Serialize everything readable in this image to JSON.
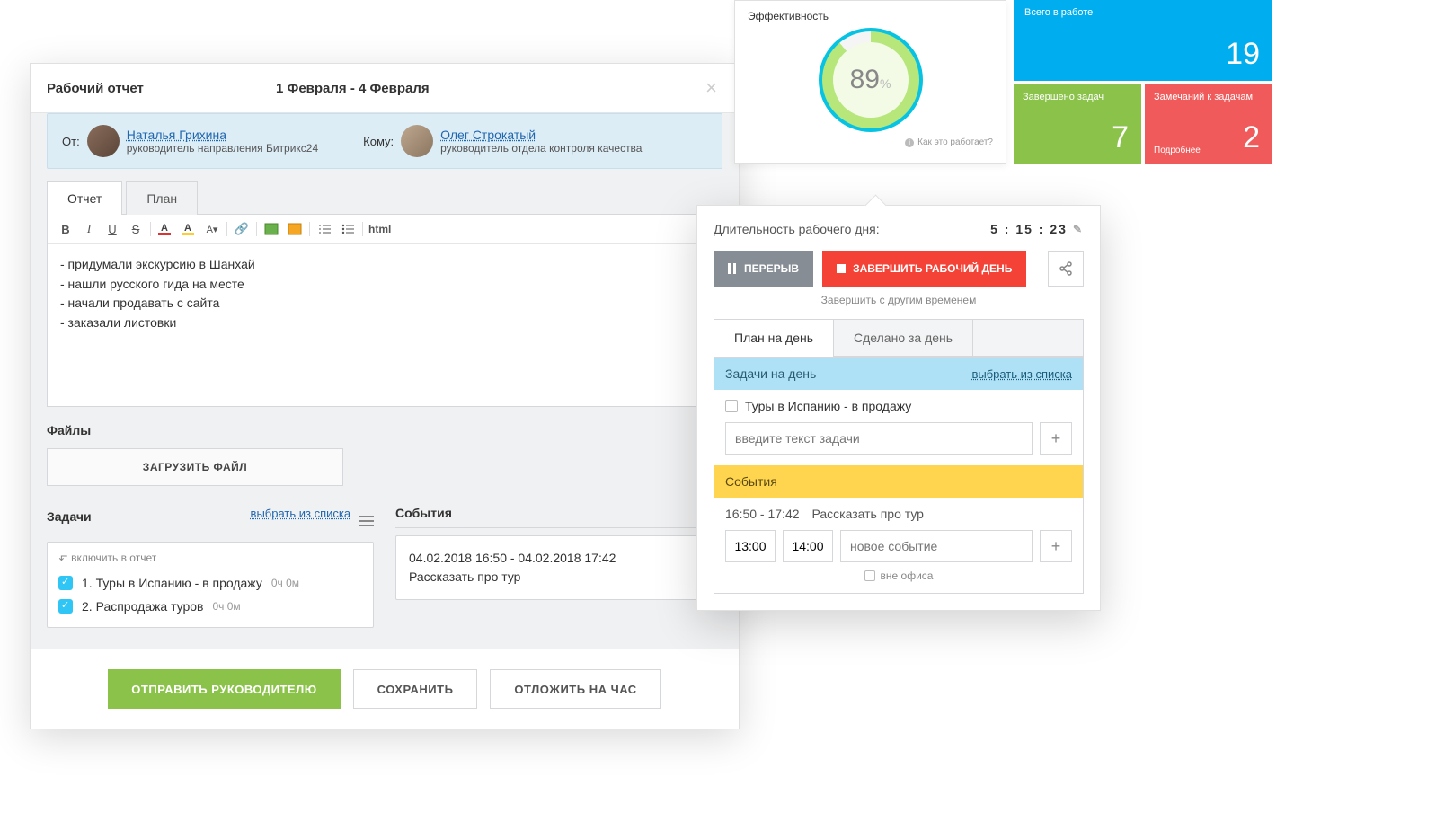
{
  "report_modal": {
    "title_left": "Рабочий отчет",
    "title_center": "1 Февраля - 4 Февраля",
    "from_label": "От:",
    "to_label": "Кому:",
    "from_person": {
      "name": "Наталья Грихина",
      "role": "руководитель направления Битрикс24"
    },
    "to_person": {
      "name": "Олег Строкатый",
      "role": "руководитель отдела контроля качества"
    },
    "tabs": {
      "report": "Отчет",
      "plan": "План"
    },
    "toolbar": {
      "html": "html"
    },
    "editor_lines": [
      "- придумали экскурсию в Шанхай",
      "- нашли русского гида на месте",
      "- начали продавать с сайта",
      "- заказали листовки"
    ],
    "files_label": "Файлы",
    "upload_label": "ЗАГРУЗИТЬ ФАЙЛ",
    "tasks": {
      "title": "Задачи",
      "select_link": "выбрать из списка",
      "include_caption": "включить в отчет",
      "items": [
        {
          "text": "1. Туры в Испанию - в продажу",
          "time": "0ч 0м"
        },
        {
          "text": "2. Распродажа туров",
          "time": "0ч 0м"
        }
      ]
    },
    "events": {
      "title": "События",
      "line1": "04.02.2018 16:50 - 04.02.2018 17:42",
      "line2": "Рассказать про тур"
    },
    "buttons": {
      "send": "ОТПРАВИТЬ РУКОВОДИТЕЛЮ",
      "save": "СОХРАНИТЬ",
      "delay": "ОТЛОЖИТЬ НА ЧАС"
    }
  },
  "efficiency": {
    "title": "Эффективность",
    "value": "89",
    "pct": "%",
    "footer": "Как это работает?"
  },
  "tiles": {
    "in_work": {
      "title": "Всего в работе",
      "value": "19"
    },
    "done": {
      "title": "Завершено задач",
      "value": "7"
    },
    "notes": {
      "title": "Замечаний к задачам",
      "more": "Подробнее",
      "value": "2"
    }
  },
  "day_panel": {
    "duration_label": "Длительность рабочего дня:",
    "duration_value": "5 : 15 : 23",
    "pause": "ПЕРЕРЫВ",
    "end": "ЗАВЕРШИТЬ РАБОЧИЙ ДЕНЬ",
    "other_time": "Завершить с другим временем",
    "tabs": {
      "plan": "План на день",
      "done": "Сделано за день"
    },
    "tasks_header": "Задачи на день",
    "tasks_select": "выбрать из списка",
    "task_item": "Туры в Испанию - в продажу",
    "task_placeholder": "введите текст задачи",
    "events_header": "События",
    "event_time": "16:50 - 17:42",
    "event_text": "Рассказать про тур",
    "new_event_start": "13:00",
    "new_event_end": "14:00",
    "new_event_placeholder": "новое событие",
    "out_of_office": "вне офиса"
  },
  "colors": {
    "green": "#8bc34a",
    "blue": "#00aeef",
    "red": "#f44336",
    "teal": "#06c3e4"
  }
}
